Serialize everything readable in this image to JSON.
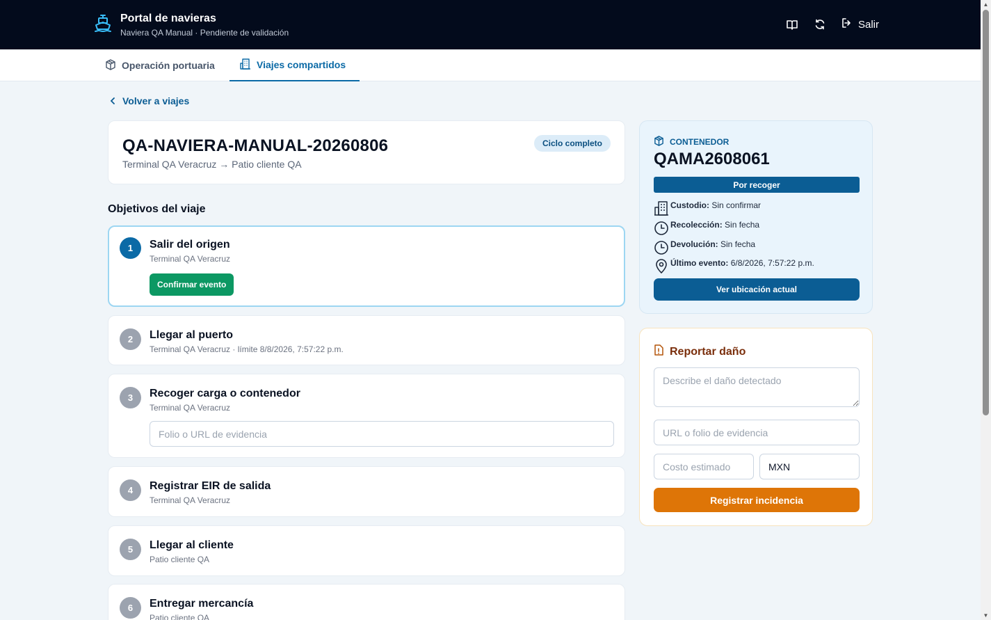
{
  "header": {
    "title": "Portal de navieras",
    "subtitle": "Naviera QA Manual · Pendiente de validación",
    "logout_label": "Salir"
  },
  "tabs": [
    {
      "label": "Operación portuaria",
      "active": false
    },
    {
      "label": "Viajes compartidos",
      "active": true
    }
  ],
  "back_label": "Volver a viajes",
  "trip": {
    "code": "QA-NAVIERA-MANUAL-20260806",
    "route": "Terminal QA Veracruz → Patio cliente QA",
    "status": "Ciclo completo"
  },
  "objectives_title": "Objetivos del viaje",
  "steps": [
    {
      "num": "1",
      "title": "Salir del origen",
      "sub": "Terminal QA Veracruz",
      "action": "Confirmar evento"
    },
    {
      "num": "2",
      "title": "Llegar al puerto",
      "sub": "Terminal QA Veracruz · límite 8/8/2026, 7:57:22 p.m."
    },
    {
      "num": "3",
      "title": "Recoger carga o contenedor",
      "sub": "Terminal QA Veracruz",
      "input_placeholder": "Folio o URL de evidencia"
    },
    {
      "num": "4",
      "title": "Registrar EIR de salida",
      "sub": "Terminal QA Veracruz"
    },
    {
      "num": "5",
      "title": "Llegar al cliente",
      "sub": "Patio cliente QA"
    },
    {
      "num": "6",
      "title": "Entregar mercancía",
      "sub": "Patio cliente QA"
    }
  ],
  "container": {
    "label": "CONTENEDOR",
    "code": "QAMA2608061",
    "status": "Por recoger",
    "custody_label": "Custodio:",
    "custody_value": "Sin confirmar",
    "pickup_label": "Recolección:",
    "pickup_value": "Sin fecha",
    "return_label": "Devolución:",
    "return_value": "Sin fecha",
    "last_event_label": "Último evento:",
    "last_event_value": "6/8/2026, 7:57:22 p.m.",
    "location_button": "Ver ubicación actual"
  },
  "damage": {
    "title": "Reportar daño",
    "description_placeholder": "Describe el daño detectado",
    "evidence_placeholder": "URL o folio de evidencia",
    "cost_placeholder": "Costo estimado",
    "currency_value": "MXN",
    "submit_label": "Registrar incidencia"
  },
  "colors": {
    "topbar": "#030b1c",
    "accent": "#0b5d94",
    "success": "#0c9863",
    "warning": "#de7507"
  }
}
